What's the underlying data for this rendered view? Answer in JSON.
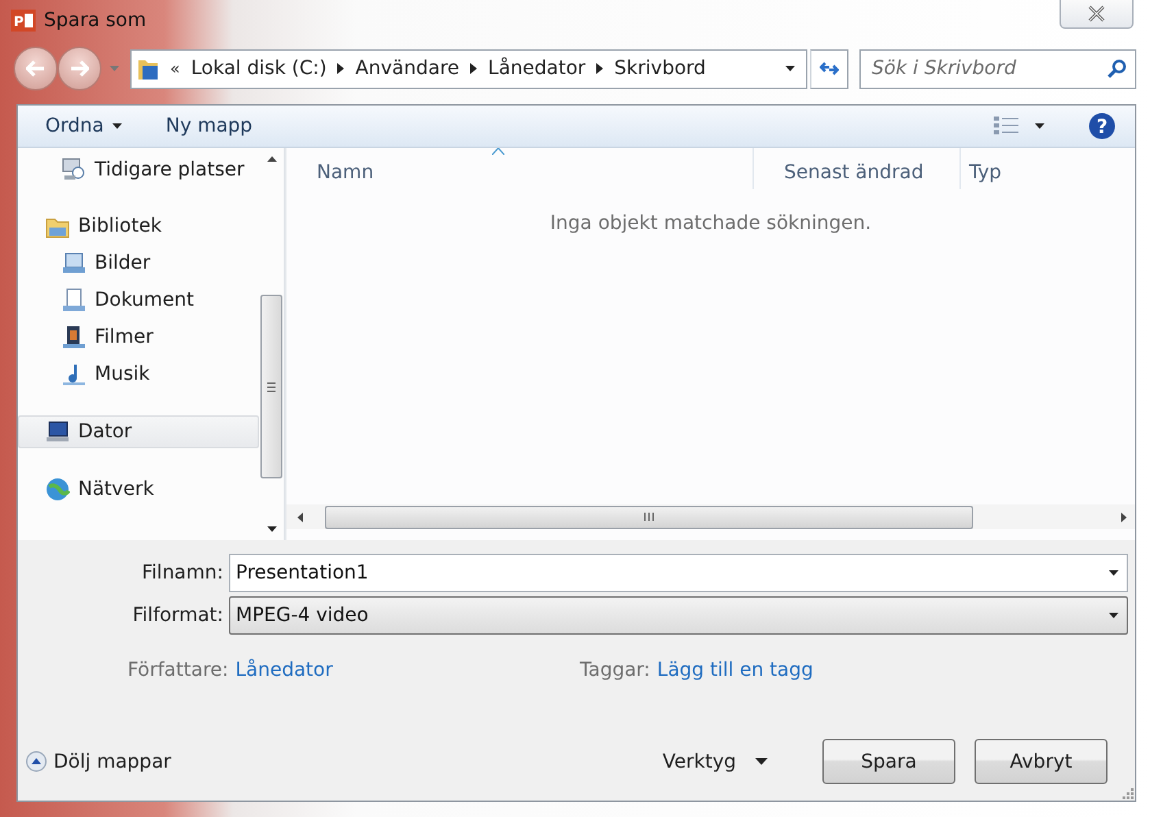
{
  "window": {
    "title": "Spara som",
    "app_icon_letter": "P"
  },
  "help_glyph": "?",
  "address_bar": {
    "overflow": "«",
    "crumbs": [
      "Lokal disk (C:)",
      "Användare",
      "Lånedator",
      "Skrivbord"
    ]
  },
  "search": {
    "placeholder": "Sök i Skrivbord"
  },
  "toolbar": {
    "organize": "Ordna",
    "new_folder": "Ny mapp"
  },
  "nav": [
    {
      "children": [
        {
          "label": "Tidigare platser",
          "kind": "recent",
          "selected": false
        }
      ]
    },
    {
      "label": "Bibliotek",
      "kind": "library",
      "selected": false,
      "children": [
        {
          "label": "Bilder",
          "kind": "pictures",
          "selected": false
        },
        {
          "label": "Dokument",
          "kind": "documents",
          "selected": false
        },
        {
          "label": "Filmer",
          "kind": "videos",
          "selected": false
        },
        {
          "label": "Musik",
          "kind": "music",
          "selected": false
        }
      ]
    },
    {
      "label": "Dator",
      "kind": "computer",
      "selected": true
    },
    {
      "label": "Nätverk",
      "kind": "network",
      "selected": false
    }
  ],
  "columns": [
    {
      "label": "Namn",
      "sorted": true
    },
    {
      "label": "Senast ändrad",
      "sorted": false
    },
    {
      "label": "Typ",
      "sorted": false
    }
  ],
  "empty_message": "Inga objekt matchade sökningen.",
  "filename": {
    "label": "Filnamn:",
    "value": "Presentation1"
  },
  "format": {
    "label": "Filformat:",
    "value": "MPEG-4 video"
  },
  "author": {
    "label": "Författare:",
    "value": "Lånedator"
  },
  "tags": {
    "label": "Taggar:",
    "value": "Lägg till en tagg"
  },
  "hide_folders": "Dölj mappar",
  "tools": "Verktyg",
  "buttons": [
    "Spara",
    "Avbryt"
  ]
}
